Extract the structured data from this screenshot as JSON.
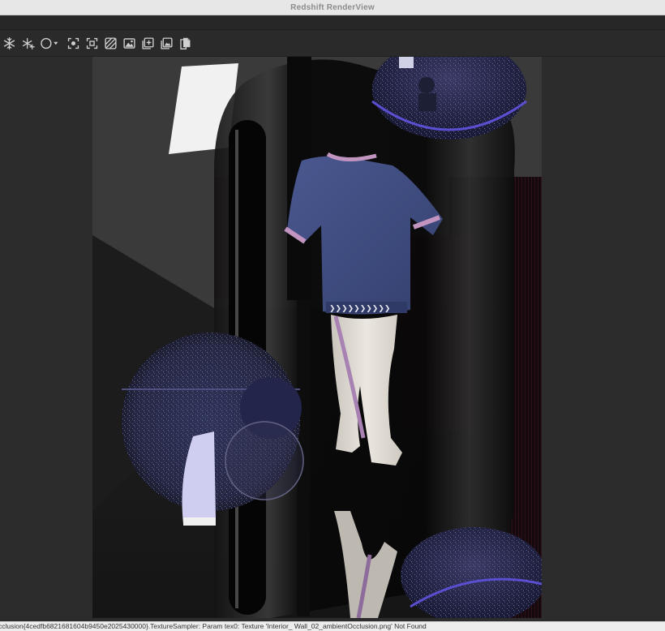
{
  "window": {
    "title": "Redshift RenderView"
  },
  "toolbar": {
    "buttons": [
      {
        "icon": "snowflake-icon"
      },
      {
        "icon": "snowflake-plus-icon"
      },
      {
        "icon": "circle-dropdown-icon"
      },
      {
        "icon": "region-focus-icon"
      },
      {
        "icon": "frame-fit-icon"
      },
      {
        "icon": "brush-adjust-icon"
      },
      {
        "icon": "image-icon"
      },
      {
        "icon": "snapshot-add-icon"
      },
      {
        "icon": "image-compare-icon"
      },
      {
        "icon": "copy-icon"
      }
    ]
  },
  "render": {
    "description_source": "3D render preview of tracksuit with reflective rings"
  },
  "status": {
    "message": "cclusion{4cedfb6821681604b9450e2025430000}.TextureSampler: Param tex0: Texture 'Interior_ Wall_02_ambientOcclusion.png' Not Found"
  },
  "colors": {
    "shirt": "#3e4a7c",
    "trim": "#b88ab6",
    "pants": "#dcd7d0",
    "curtain": "#4a1224",
    "disc": "#2c2f52",
    "highlight": "#5a4fd0"
  }
}
